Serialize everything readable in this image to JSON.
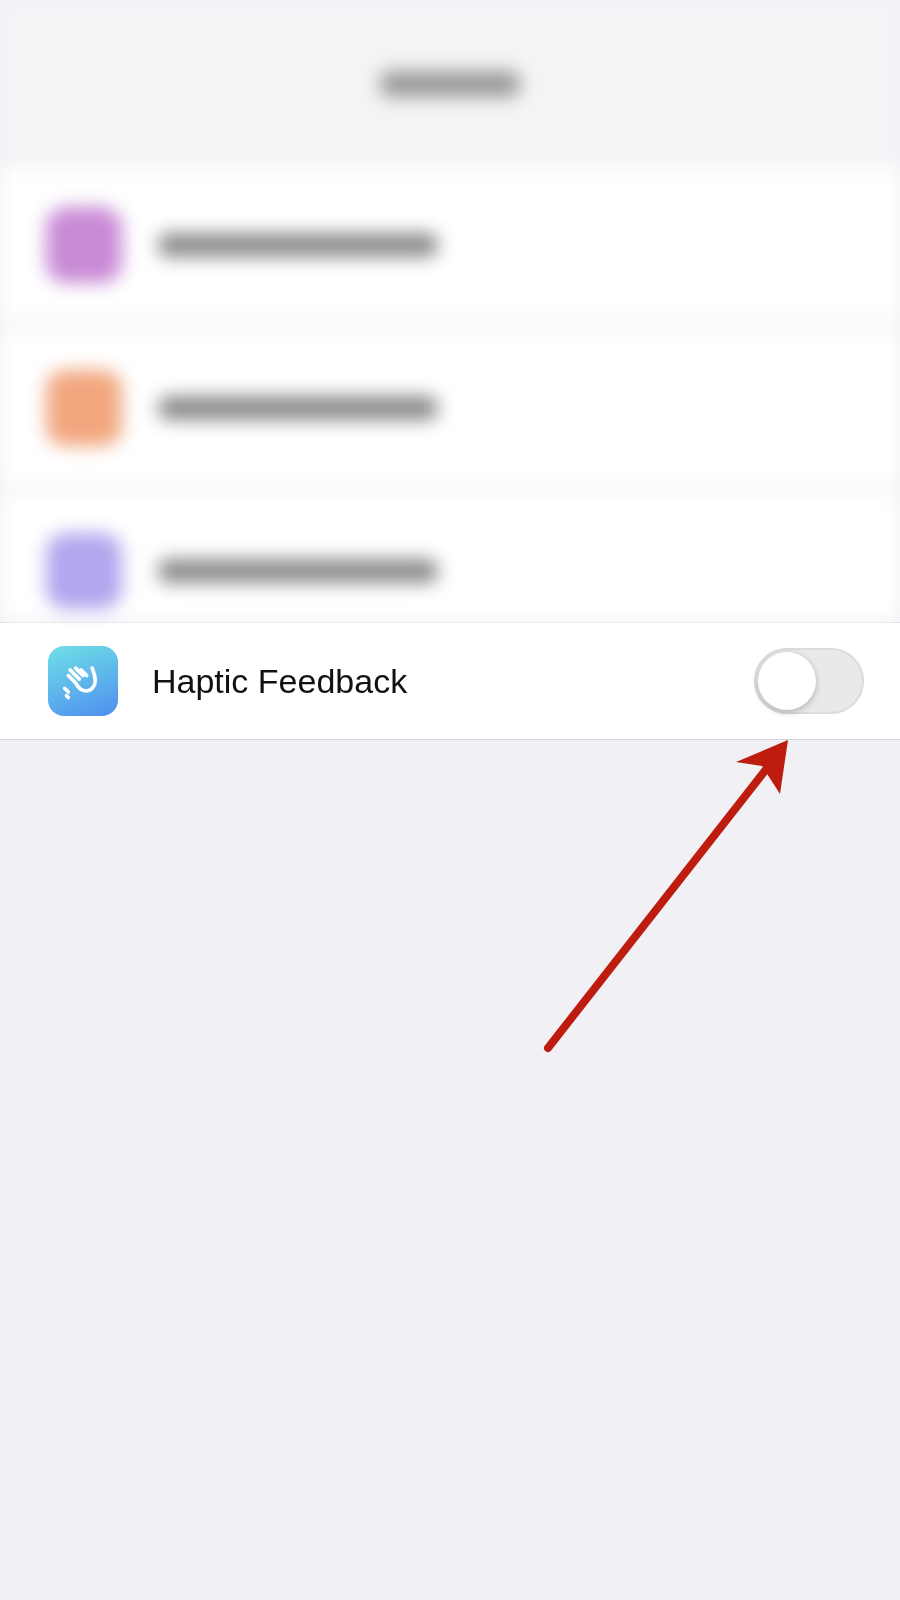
{
  "blurred_rows": [
    {
      "color": "#c98bd6"
    },
    {
      "color": "#f2a77f"
    },
    {
      "color": "#b3a6ee"
    }
  ],
  "settings_row": {
    "label": "Haptic Feedback",
    "on": false
  },
  "annotation": {
    "kind": "arrow",
    "color": "#bf1c10"
  }
}
